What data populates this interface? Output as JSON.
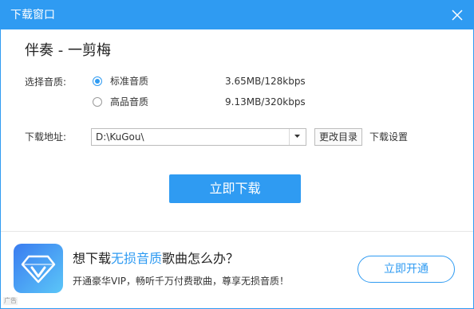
{
  "window": {
    "title": "下载窗口",
    "close_icon": "close-icon"
  },
  "song": {
    "title": "伴奏 - 一剪梅"
  },
  "quality": {
    "label": "选择音质:",
    "options": [
      {
        "name": "标准音质",
        "spec": "3.65MB/128kbps",
        "selected": true
      },
      {
        "name": "高品音质",
        "spec": "9.13MB/320kbps",
        "selected": false
      }
    ]
  },
  "location": {
    "label": "下载地址:",
    "path": "D:\\KuGou\\",
    "dropdown_icon": "chevron-down-icon",
    "change_dir_label": "更改目录",
    "settings_label": "下载设置"
  },
  "download_button": {
    "label": "立即下载"
  },
  "promo": {
    "logo_icon": "vip-diamond-icon",
    "title_prefix": "想下载",
    "title_highlight": "无损音质",
    "title_suffix": "歌曲怎么办？",
    "subtitle": "开通豪华VIP，畅听千万付费歌曲，尊享无损音质！",
    "button_label": "立即开通",
    "ad_tag": "广告"
  },
  "colors": {
    "accent": "#2f9bf2",
    "titlebar": "#2f9bf2"
  }
}
